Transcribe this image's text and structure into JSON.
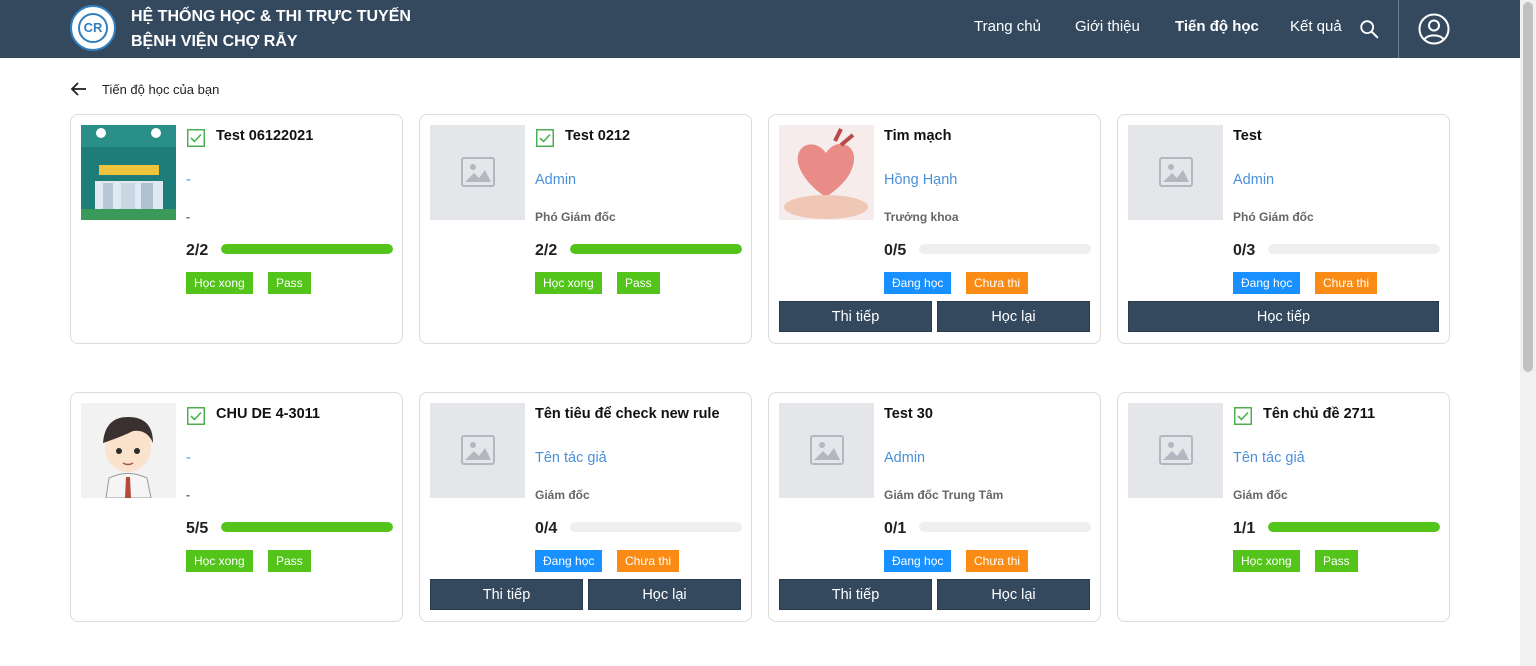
{
  "header": {
    "logo_text": "CR",
    "brand_line1": "HỆ THỐNG HỌC & THI TRỰC TUYẾN",
    "brand_line2": "BỆNH VIỆN CHỢ RẪY",
    "nav": [
      "Trang chủ",
      "Giới thiệu",
      "Tiến độ học",
      "Kết quả"
    ],
    "active_nav": "Tiến độ học",
    "search_icon": "search-icon",
    "user_icon": "user-account-icon"
  },
  "breadcrumb": {
    "label": "Tiến độ học của bạn",
    "icon": "arrow-left-icon"
  },
  "colors": {
    "header_bg": "#34495e",
    "progress_fill": "#52c41a",
    "badge_done": "#52c41a",
    "badge_learning": "#1890ff",
    "badge_not_tested": "#fa8c16",
    "author_link": "#4a90d9",
    "button_bg": "#34495e"
  },
  "cards": [
    {
      "title": "Test 06122021",
      "checked": true,
      "author": "-",
      "position": "-",
      "progress_text": "2/2",
      "progress": 1.0,
      "badges": [
        {
          "label": "Học xong",
          "kind": "done"
        },
        {
          "label": "Pass",
          "kind": "done"
        }
      ],
      "buttons": [],
      "thumbnail": "poster"
    },
    {
      "title": "Test 0212",
      "checked": true,
      "author": "Admin",
      "position": "Phó Giám đốc",
      "progress_text": "2/2",
      "progress": 1.0,
      "badges": [
        {
          "label": "Học xong",
          "kind": "done"
        },
        {
          "label": "Pass",
          "kind": "done"
        }
      ],
      "buttons": [],
      "thumbnail": "placeholder"
    },
    {
      "title": "Tim mạch",
      "checked": false,
      "author": "Hồng Hạnh",
      "position": "Trưởng khoa",
      "progress_text": "0/5",
      "progress": 0,
      "badges": [
        {
          "label": "Đang học",
          "kind": "learning"
        },
        {
          "label": "Chưa thi",
          "kind": "not-tested"
        }
      ],
      "buttons": [
        "Thi tiếp",
        "Học lại"
      ],
      "thumbnail": "heart"
    },
    {
      "title": "Test",
      "checked": false,
      "author": "Admin",
      "position": "Phó Giám đốc",
      "progress_text": "0/3",
      "progress": 0,
      "badges": [
        {
          "label": "Đang học",
          "kind": "learning"
        },
        {
          "label": "Chưa thi",
          "kind": "not-tested"
        }
      ],
      "buttons": [
        "Học tiếp"
      ],
      "thumbnail": "placeholder"
    },
    {
      "title": "CHU DE 4-3011",
      "checked": true,
      "author": "-",
      "position": "-",
      "progress_text": "5/5",
      "progress": 1.0,
      "badges": [
        {
          "label": "Học xong",
          "kind": "done"
        },
        {
          "label": "Pass",
          "kind": "done"
        }
      ],
      "buttons": [],
      "thumbnail": "avatar"
    },
    {
      "title": "Tên tiêu để check new rule",
      "checked": false,
      "author": "Tên tác giả",
      "position": "Giám đốc",
      "progress_text": "0/4",
      "progress": 0,
      "badges": [
        {
          "label": "Đang học",
          "kind": "learning"
        },
        {
          "label": "Chưa thi",
          "kind": "not-tested"
        }
      ],
      "buttons": [
        "Thi tiếp",
        "Học lại"
      ],
      "thumbnail": "placeholder"
    },
    {
      "title": "Test 30",
      "checked": false,
      "author": "Admin",
      "position": "Giám đốc Trung Tâm",
      "progress_text": "0/1",
      "progress": 0,
      "badges": [
        {
          "label": "Đang học",
          "kind": "learning"
        },
        {
          "label": "Chưa thi",
          "kind": "not-tested"
        }
      ],
      "buttons": [
        "Thi tiếp",
        "Học lại"
      ],
      "thumbnail": "placeholder"
    },
    {
      "title": "Tên chủ đề 2711",
      "checked": true,
      "author": "Tên tác giả",
      "position": "Giám đốc",
      "progress_text": "1/1",
      "progress": 1.0,
      "badges": [
        {
          "label": "Học xong",
          "kind": "done"
        },
        {
          "label": "Pass",
          "kind": "done"
        }
      ],
      "buttons": [],
      "thumbnail": "placeholder"
    }
  ]
}
